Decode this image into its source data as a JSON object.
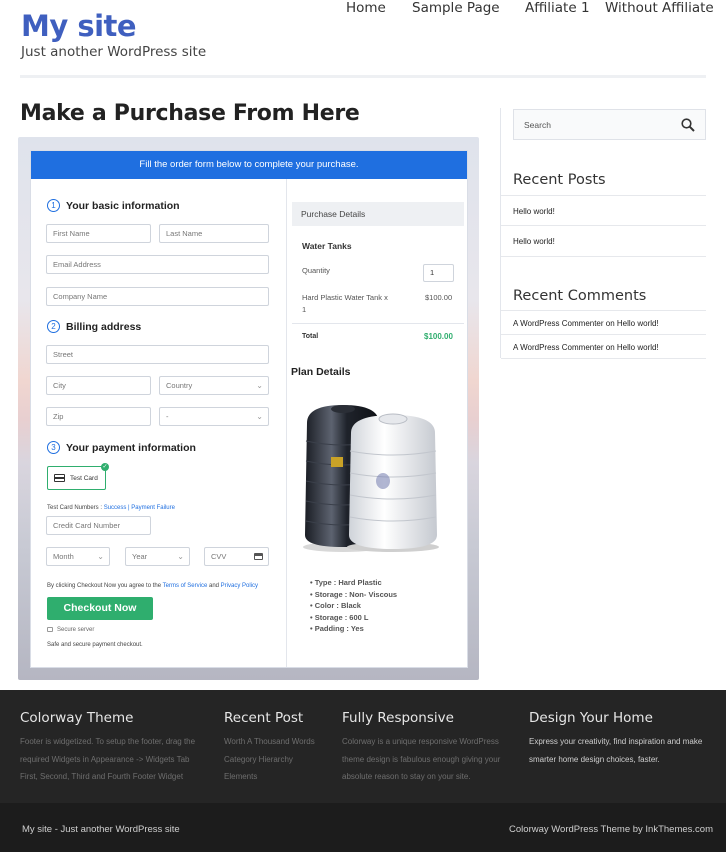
{
  "site": {
    "title": "My site",
    "tagline": "Just another WordPress site"
  },
  "nav": {
    "items": [
      "Home",
      "Sample Page",
      "Affiliate 1",
      "Without Affiliate"
    ]
  },
  "page": {
    "title": "Make a Purchase From Here"
  },
  "form": {
    "banner": "Fill the order form below to complete your purchase.",
    "section1": {
      "num": "1",
      "title": "Your basic information"
    },
    "first_name": "First Name",
    "last_name": "Last Name",
    "email": "Email Address",
    "company": "Company Name",
    "section2": {
      "num": "2",
      "title": "Billing address"
    },
    "street": "Street",
    "city": "City",
    "country": "Country",
    "zip": "Zip",
    "state": "-",
    "section3": {
      "num": "3",
      "title": "Your payment information"
    },
    "test_card_label": "Test Card",
    "test_numbers_label": "Test Card Numbers : ",
    "success_link": "Success",
    "separator": " | ",
    "failure_link": "Payment Failure",
    "credit_card": "Credit Card Number",
    "month": "Month",
    "year": "Year",
    "cvv": "CVV",
    "agree_prefix": "By clicking Checkout Now you agree to the ",
    "tos_link": "Terms of Service",
    "and_text": " and ",
    "privacy_link": "Privacy Policy",
    "checkout_button": "Checkout Now",
    "secure_server": "Secure server",
    "safe_text": "Safe and secure payment checkout."
  },
  "purchase": {
    "header": "Purchase Details",
    "product_name": "Water Tanks",
    "quantity_label": "Quantity",
    "quantity_value": "1",
    "item_line1": "Hard Plastic Water Tank x",
    "item_line2": "1",
    "item_price": "$100.00",
    "total_label": "Total",
    "total_value": "$100.00",
    "plan_title": "Plan Details",
    "plan_items": [
      "Type : Hard Plastic",
      "Storage : Non- Viscous",
      "Color : Black",
      "Storage : 600 L",
      "Padding : Yes"
    ]
  },
  "sidebar": {
    "search_placeholder": "Search",
    "recent_posts_title": "Recent Posts",
    "recent_posts": [
      "Hello world!",
      "Hello world!"
    ],
    "recent_comments_title": "Recent Comments",
    "recent_comments": [
      {
        "author": "A WordPress Commenter",
        "on": " on ",
        "post": "Hello world!"
      },
      {
        "author": "A WordPress Commenter",
        "on": " on ",
        "post": "Hello world!"
      }
    ]
  },
  "footer": {
    "col1": {
      "title": "Colorway Theme",
      "lines": [
        "Footer is widgetized. To setup the footer, drag the",
        "required Widgets in Appearance -> Widgets Tab",
        "First, Second, Third and Fourth Footer Widget"
      ]
    },
    "col2": {
      "title": "Recent Post",
      "lines": [
        "Worth A Thousand Words",
        "Category Hierarchy",
        "Elements"
      ]
    },
    "col3": {
      "title": "Fully Responsive",
      "lines": [
        "Colorway is a unique responsive WordPress",
        "theme design is fabulous enough giving your",
        "absolute reason to stay on your site."
      ]
    },
    "col4": {
      "title": "Design Your Home",
      "lines": [
        "Express your creativity, find inspiration and make",
        "smarter home design choices, faster."
      ]
    },
    "bottom_left": "My site - Just another WordPress site",
    "bottom_right": "Colorway WordPress Theme by InkThemes.com"
  },
  "colors": {
    "brand": "#3f5fbf",
    "banner": "#1f6fe0",
    "checkout": "#2fae6e",
    "total_price": "#2fae6e",
    "footer_bg": "#252525"
  }
}
